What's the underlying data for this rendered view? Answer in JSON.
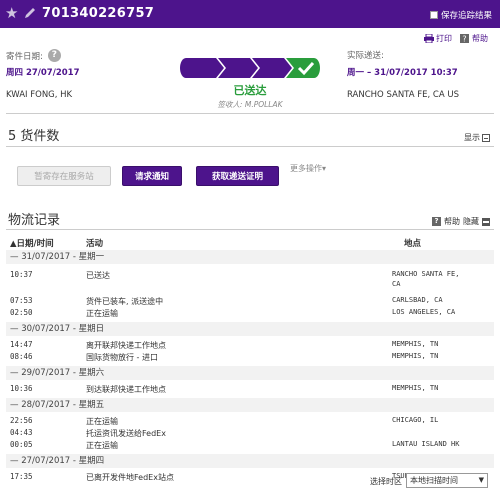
{
  "header": {
    "tracking_number": "701340226757",
    "save_label": "保存追踪结果",
    "print_label": "打印",
    "help_label": "帮助"
  },
  "shipment": {
    "ship_date_label": "寄件日期:",
    "ship_date": "周四 27/07/2017",
    "origin": "KWAI FONG, HK",
    "delivery_label": "实际递送:",
    "delivery_date": "周一 – 31/07/2017 10:37",
    "destination": "RANCHO SANTA FE, CA US",
    "status": "已送达",
    "signer": "签收人: M.POLLAK",
    "progress_steps": 4,
    "progress_complete": 4
  },
  "pieces": {
    "title": "5 货件数",
    "show_label": "显示",
    "hold_button": "暂寄存在服务站",
    "notify_button": "请求通知",
    "proof_button": "获取递送证明",
    "more_label": "更多操作▾"
  },
  "history": {
    "title": "物流记录",
    "help_label": "帮助",
    "hide_label": "隐藏",
    "col_date": "▲日期/时间",
    "col_activity": "活动",
    "col_location": "地点",
    "groups": [
      {
        "date": "—  31/07/2017 - 星期一",
        "events": [
          {
            "time": "10:37",
            "activity": "已送达",
            "location": "RANCHO SANTA FE,",
            "location2": "CA"
          },
          {
            "time": "07:53",
            "activity": "货件已装车, 派送途中",
            "location": "CARLSBAD, CA"
          },
          {
            "time": "02:50",
            "activity": "正在运输",
            "location": "LOS ANGELES, CA"
          }
        ]
      },
      {
        "date": "—  30/07/2017 - 星期日",
        "events": [
          {
            "time": "14:47",
            "activity": "离开联邦快递工作地点",
            "location": "MEMPHIS, TN"
          },
          {
            "time": "08:46",
            "activity": "国际货物放行 - 进口",
            "location": "MEMPHIS, TN"
          }
        ]
      },
      {
        "date": "—  29/07/2017 - 星期六",
        "events": [
          {
            "time": "10:36",
            "activity": "到达联邦快递工作地点",
            "location": "MEMPHIS, TN"
          }
        ]
      },
      {
        "date": "—  28/07/2017 - 星期五",
        "events": [
          {
            "time": "22:56",
            "activity": "正在运输",
            "location": "CHICAGO, IL"
          },
          {
            "time": "04:43",
            "activity": "托运资讯发送给FedEx",
            "location": ""
          },
          {
            "time": "00:05",
            "activity": "正在运输",
            "location": "LANTAU ISLAND HK"
          }
        ]
      },
      {
        "date": "—  27/07/2017 - 星期四",
        "events": [
          {
            "time": "17:35",
            "activity": "已离开发件地FedEx站点",
            "location": "TSUEN WAN HK"
          }
        ]
      }
    ],
    "tz_label": "选择时区",
    "tz_value": "本地扫描时间"
  },
  "colors": {
    "brand": "#4d148c",
    "delivered": "#2a9d3c"
  }
}
